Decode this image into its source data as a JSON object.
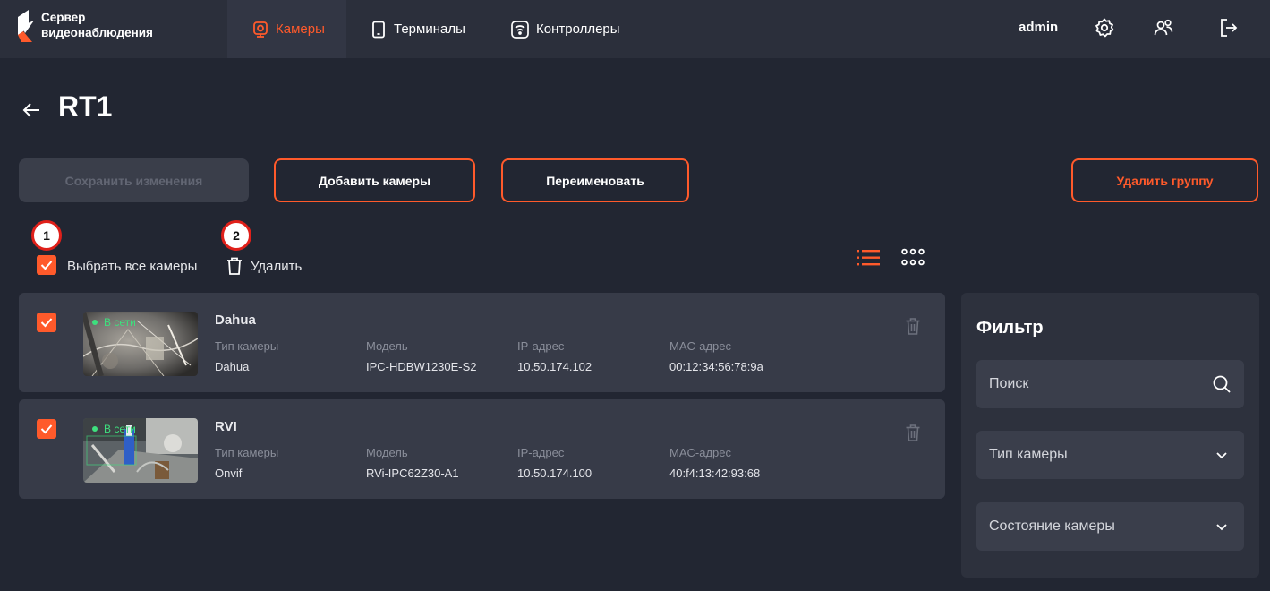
{
  "header": {
    "logo_line1": "Сервер",
    "logo_line2": "видеонаблюдения",
    "tabs": [
      {
        "label": "Камеры"
      },
      {
        "label": "Терминалы"
      },
      {
        "label": "Контроллеры"
      }
    ],
    "user": "admin"
  },
  "page": {
    "title": "RT1",
    "save_label": "Сохранить изменения",
    "add_cameras_label": "Добавить камеры",
    "rename_label": "Переименовать",
    "delete_group_label": "Удалить группу"
  },
  "toolbar": {
    "badge1": "1",
    "badge2": "2",
    "select_all_label": "Выбрать все камеры",
    "delete_label": "Удалить"
  },
  "cameras": [
    {
      "name": "Dahua",
      "status": "В сети",
      "type_label": "Тип камеры",
      "type": "Dahua",
      "model_label": "Модель",
      "model": "IPC-HDBW1230E-S2",
      "ip_label": "IP-адрес",
      "ip": "10.50.174.102",
      "mac_label": "MAC-адрес",
      "mac": "00:12:34:56:78:9a"
    },
    {
      "name": "RVI",
      "status": "В сети",
      "type_label": "Тип камеры",
      "type": "Onvif",
      "model_label": "Модель",
      "model": "RVi-IPC62Z30-A1",
      "ip_label": "IP-адрес",
      "ip": "10.50.174.100",
      "mac_label": "MAC-адрес",
      "mac": "40:f4:13:42:93:68"
    }
  ],
  "filter": {
    "title": "Фильтр",
    "search_placeholder": "Поиск",
    "camera_type_label": "Тип камеры",
    "camera_state_label": "Состояние камеры"
  },
  "colors": {
    "accent": "#ff5a2b",
    "background": "#222632",
    "online": "#3ee07e"
  }
}
